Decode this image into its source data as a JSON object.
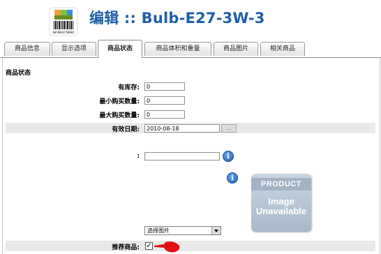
{
  "header": {
    "title": "编辑 :: Bulb-E27-3W-3",
    "logo_icon": "barcode-box-icon",
    "logo_barcode_number": "6078943758901"
  },
  "tabs": [
    {
      "label": "商品信息"
    },
    {
      "label": "显示选项"
    },
    {
      "label": "商品状态",
      "active": true
    },
    {
      "label": "商品体积和重量"
    },
    {
      "label": "商品图片"
    },
    {
      "label": "相关商品"
    }
  ],
  "section": {
    "title": "商品状态"
  },
  "fields": {
    "stock_label": "有库存:",
    "stock_value": "0",
    "min_qty_label": "最小购买数量:",
    "min_qty_value": "0",
    "max_qty_label": "最大购买数量:",
    "max_qty_value": "0",
    "date_label": "有效日期:",
    "date_value": "2010-08-18",
    "date_button": "...",
    "blank_label": ":",
    "blank_value": ""
  },
  "image": {
    "line1": "PRODUCT",
    "line2": "Image",
    "line3": "Unavailable",
    "select_value": "选择图片"
  },
  "featured": {
    "label": "推荐商品:",
    "checked_mark": "✓"
  },
  "colors": {
    "title": "#1f5fa8",
    "info": "#1e5fb4",
    "annotation": "#e01010"
  }
}
